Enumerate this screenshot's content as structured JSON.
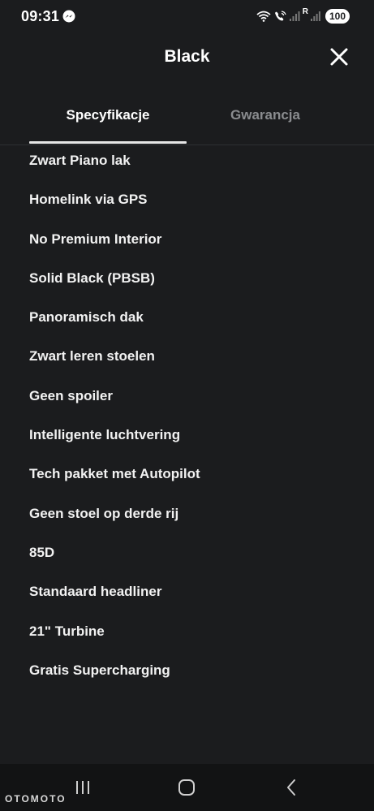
{
  "status_bar": {
    "time": "09:31",
    "carrier_label": "R",
    "battery": "100"
  },
  "header": {
    "title": "Black"
  },
  "tabs": [
    {
      "label": "Specyfikacje",
      "active": true
    },
    {
      "label": "Gwarancja",
      "active": false
    }
  ],
  "specs": [
    "Zwart Piano lak",
    "Homelink via GPS",
    "No Premium Interior",
    "Solid Black (PBSB)",
    "Panoramisch dak",
    "Zwart leren stoelen",
    "Geen spoiler",
    "Intelligente luchtvering",
    "Tech pakket met Autopilot",
    "Geen stoel op derde rij",
    "85D",
    "Standaard headliner",
    "21\" Turbine",
    "Gratis Supercharging"
  ],
  "watermark": "OTOMOTO",
  "icons": {
    "close": "close-icon",
    "recents": "recents-icon",
    "home": "home-icon",
    "back": "back-icon"
  },
  "colors": {
    "background": "#1b1c1e",
    "text": "#ffffff",
    "inactive_tab": "#8a8c8f",
    "nav_bar": "#121314"
  }
}
